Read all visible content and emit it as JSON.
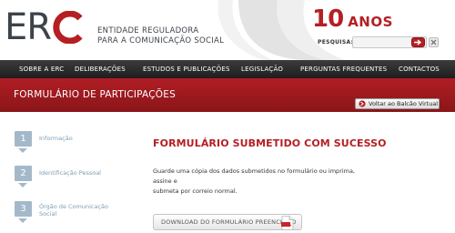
{
  "header": {
    "logo_text": "ER",
    "entity_line1": "ENTIDADE REGULADORA",
    "entity_line2": "PARA A COMUNICAÇÃO SOCIAL",
    "anniversary_number": "10",
    "anniversary_word": "ANOS",
    "search_label": "PESQUISA:",
    "search_value": "",
    "search_placeholder": ""
  },
  "nav": {
    "items": [
      {
        "label": "SOBRE A ERC"
      },
      {
        "label": "DELIBERAÇÕES"
      },
      {
        "label": "ESTUDOS E PUBLICAÇÕES"
      },
      {
        "label": "LEGISLAÇÃO"
      },
      {
        "label": "PERGUNTAS FREQUENTES"
      },
      {
        "label": "CONTACTOS"
      }
    ]
  },
  "banner": {
    "title": "FORMULÁRIO DE PARTICIPAÇÕES",
    "back_button": "Voltar ao Balcão Virtual"
  },
  "steps": [
    {
      "number": "1",
      "label": "Informação"
    },
    {
      "number": "2",
      "label": "Identificação Pessoal"
    },
    {
      "number": "3",
      "label": "Órgão de Comunicação Social"
    }
  ],
  "main": {
    "title": "FORMULÁRIO SUBMETIDO COM SUCESSO",
    "message_line1": "Guarde uma cópia dos dados submetidos no formulário ou imprima, assine e",
    "message_line2": "submeta por correio normal.",
    "download_button": "DOWNLOAD DO FORMULÁRIO PREENCHIDO"
  },
  "colors": {
    "brand_red": "#b51f24",
    "nav_bg": "#2a2a2a",
    "step_blue": "#a3b9c9",
    "logo_gray": "#3d434a"
  },
  "icons": {
    "search_button": "arrow-right-icon",
    "clear_button": "close-icon",
    "back_button": "arrow-right-icon",
    "download_button": "pdf-icon"
  }
}
